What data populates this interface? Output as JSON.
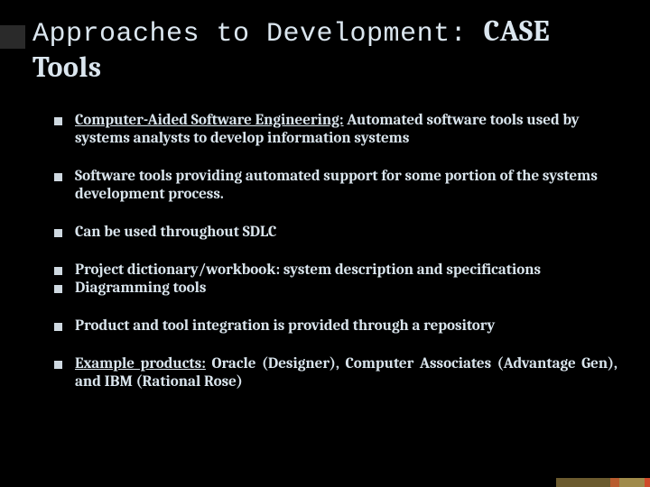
{
  "title": {
    "prefix": "Approaches to Development: ",
    "emphasis": "CASE Tools"
  },
  "bullets": {
    "b1_underline": "Computer-Aided Software Engineering:",
    "b1_rest": " Automated software tools used by systems analysts to develop information systems",
    "b2": "Software tools providing automated support for some portion of the systems development process.",
    "b3": "Can be used throughout SDLC",
    "b4": "Project dictionary/workbook: system description and specifications",
    "b5": "Diagramming tools",
    "b6": "Product and tool integration is provided through a repository",
    "b7_underline": "Example products:",
    "b7_rest": " Oracle (Designer), Computer Associates (Advantage Gen), and IBM (Rational Rose)"
  }
}
